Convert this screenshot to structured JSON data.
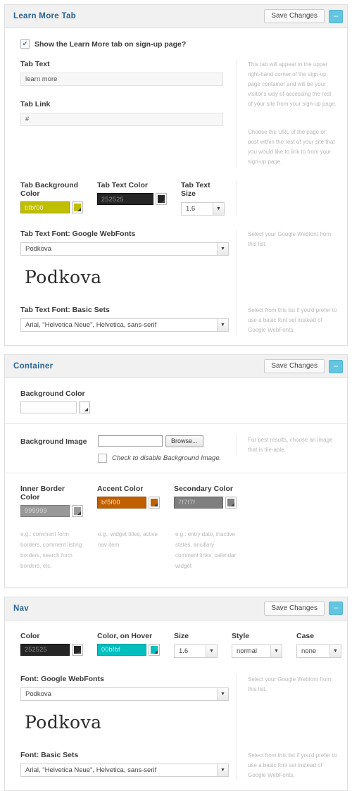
{
  "common": {
    "save_label": "Save Changes",
    "collapse_label": "–",
    "browse_label": "Browse...",
    "select_arrow": "▼",
    "check_mark": "✔",
    "google_webfont_help": "Select your Google Webfont from this list.",
    "basic_set_help": "Select from this list if you'd prefer to use a basic font set instead of Google WebFonts.",
    "font_preview_text": "Podkova",
    "google_font_value": "Podkova",
    "basic_font_value": "Arial, \"Helvetica Neue\", Helvetica, sans-serif"
  },
  "panels": [
    {
      "id": "learn-more-tab",
      "title": "Learn More Tab",
      "checkbox": {
        "label": "Show the Learn More tab on sign-up page?",
        "checked": true
      },
      "fields": {
        "tab_text_label": "Tab Text",
        "tab_text_value": "learn more",
        "tab_text_help": "This tab will appear in the upper right-hand corner of the sign-up page container and will be your visitor's way of accessing the rest of your site from your sign-up page.",
        "tab_link_label": "Tab Link",
        "tab_link_value": "#",
        "tab_link_help": "Choose the URL of the page or post within the rest of your site that you would like to link to from your sign-up page.",
        "bg_color_label": "Tab Background Color",
        "bg_color_value": "bfbf00",
        "text_color_label": "Tab Text Color",
        "text_color_value": "252525",
        "text_size_label": "Tab Text Size",
        "text_size_value": "1.6",
        "google_font_label": "Tab Text Font: Google WebFonts",
        "basic_font_label": "Tab Text Font: Basic Sets"
      }
    },
    {
      "id": "container",
      "title": "Container",
      "fields": {
        "bg_color_label": "Background Color",
        "bg_color_value": "ffffff",
        "bg_image_label": "Background Image",
        "bg_image_value": "",
        "bg_image_help": "For best results, choose an image that is tile-able.",
        "disable_bg_label": "Check to disable Background Image.",
        "disable_bg_checked": false,
        "inner_border_label": "Inner Border Color",
        "inner_border_value": "999999",
        "inner_border_help": "e.g.: comment form borders, comment listing borders, search form borders, etc.",
        "accent_label": "Accent Color",
        "accent_value": "bf5f00",
        "accent_help": "e.g.: widget titles, active nav item",
        "secondary_label": "Secondary Color",
        "secondary_value": "7f7f7f",
        "secondary_help": "e.g.: entry date, inactive states, ancillary comment links, calendar widget"
      }
    },
    {
      "id": "nav",
      "title": "Nav",
      "fields": {
        "color_label": "Color",
        "color_value": "252525",
        "hover_label": "Color, on Hover",
        "hover_value": "00bfbf",
        "size_label": "Size",
        "size_value": "1.6",
        "style_label": "Style",
        "style_value": "normal",
        "case_label": "Case",
        "case_value": "none",
        "google_font_label": "Font: Google WebFonts",
        "basic_font_label": "Font: Basic Sets"
      }
    }
  ],
  "swatch_colors": {
    "tab_bg": "#bfbf00",
    "tab_text": "#252525",
    "container_bg": "#ffffff",
    "inner_border": "#999999",
    "accent": "#bf5f00",
    "secondary": "#7f7f7f",
    "nav_color": "#252525",
    "nav_hover": "#00bfbf"
  }
}
